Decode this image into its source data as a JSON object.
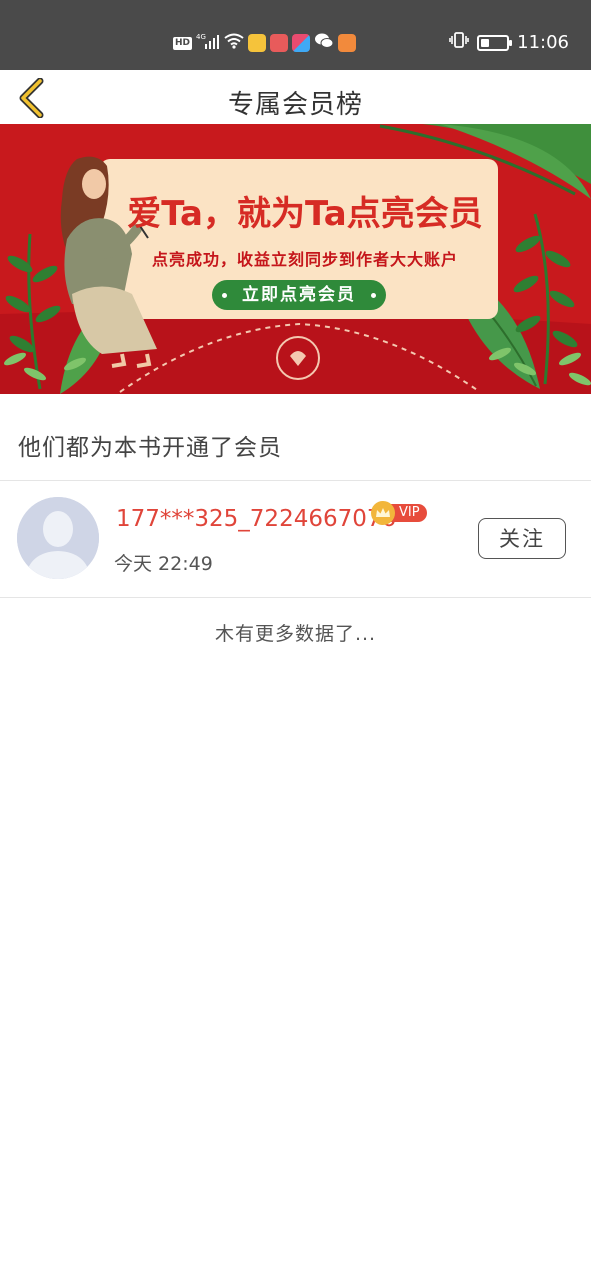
{
  "status_bar": {
    "hd_label": "HD",
    "network": "4G",
    "time": "11:06"
  },
  "header": {
    "title": "专属会员榜"
  },
  "banner": {
    "headline": "爱Ta，就为Ta点亮会员",
    "subtitle": "点亮成功，收益立刻同步到作者大大账户",
    "cta_label": "立即点亮会员",
    "colors": {
      "background": "#c8191d",
      "card": "#fbe3c4",
      "cta": "#2f8a3a"
    }
  },
  "section": {
    "heading": "他们都为本书开通了会员"
  },
  "members": [
    {
      "name": "177***325_7224667076",
      "vip_label": "VIP",
      "time": "今天 22:49",
      "follow_label": "关注"
    }
  ],
  "footer": {
    "no_more_text": "木有更多数据了..."
  },
  "colors": {
    "accent": "#e0453a",
    "back_arrow": "#f2c230"
  }
}
